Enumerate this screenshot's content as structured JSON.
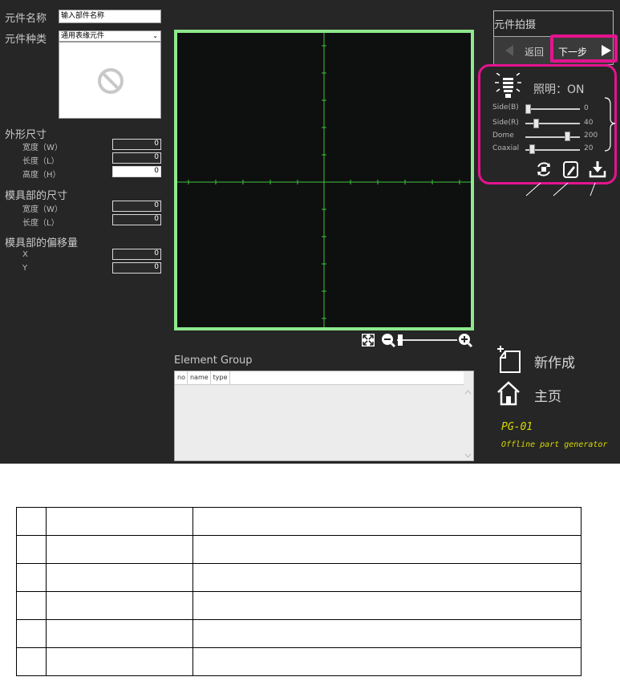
{
  "left_panel": {
    "part_name_label": "元件名称",
    "part_name_value": "输入部件名称",
    "part_type_label": "元件种类",
    "part_type_value": "通用表缘元件",
    "outer_size_title": "外形尺寸",
    "outer_size": [
      {
        "label": "宽度（W）",
        "value": "0"
      },
      {
        "label": "长度（L）",
        "value": "0"
      },
      {
        "label": "高度（H）",
        "value": "0"
      }
    ],
    "mold_size_title": "模具部的尺寸",
    "mold_size": [
      {
        "label": "宽度（W）",
        "value": "0"
      },
      {
        "label": "长度（L）",
        "value": "0"
      }
    ],
    "mold_offset_title": "模具部的偏移量",
    "mold_offset": [
      {
        "label": "X",
        "value": "0"
      },
      {
        "label": "Y",
        "value": "0"
      }
    ]
  },
  "element_group": {
    "title": "Element Group",
    "columns": [
      "no",
      "name",
      "type"
    ]
  },
  "right_panel": {
    "capture_title": "元件拍摄",
    "back_label": "返回",
    "next_label": "下一步",
    "lighting_label": "照明：ON",
    "sliders": [
      {
        "label": "Side(B)",
        "value": "0",
        "level": 0
      },
      {
        "label": "Side(R)",
        "value": "40",
        "level": 0.16
      },
      {
        "label": "Dome",
        "value": "200",
        "level": 0.8
      },
      {
        "label": "Coaxial",
        "value": "20",
        "level": 0.08
      }
    ],
    "new_label": "新作成",
    "home_label": "主页",
    "product_code": "PG-01",
    "product_desc": "Offline part generator"
  },
  "icons": {
    "lighting": "light-bulb-icon",
    "rotate": "rotate-icon",
    "edit": "edit-icon",
    "download": "download-icon",
    "new": "new-file-icon",
    "home": "home-icon",
    "fit": "fit-screen-icon",
    "zoom_out": "zoom-out-icon",
    "zoom_in": "zoom-in-icon",
    "no_image": "no-image-icon"
  },
  "colors": {
    "highlight": "#e4138f",
    "camera_border": "#8ee88e",
    "crosshair": "#3ec43e",
    "product_text": "#d9d900"
  },
  "bottom_table": {
    "rows": [
      [
        "",
        "",
        ""
      ],
      [
        "",
        "",
        ""
      ],
      [
        "",
        "",
        ""
      ],
      [
        "",
        "",
        ""
      ],
      [
        "",
        "",
        ""
      ],
      [
        "",
        "",
        ""
      ]
    ]
  }
}
